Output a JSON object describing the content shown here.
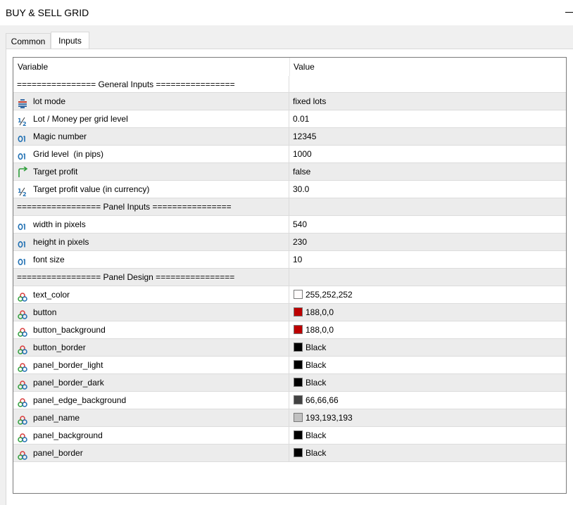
{
  "window": {
    "title": "BUY & SELL GRID"
  },
  "tabs": [
    {
      "label": "Common",
      "active": false
    },
    {
      "label": "Inputs",
      "active": true
    }
  ],
  "table": {
    "headers": {
      "variable": "Variable",
      "value": "Value"
    },
    "rows": [
      {
        "type": "separator",
        "variable": "================ General Inputs ================",
        "value": ""
      },
      {
        "type": "param",
        "icon": "list-icon",
        "variable": "lot mode",
        "value": "fixed lots"
      },
      {
        "type": "param",
        "icon": "fraction-icon",
        "variable": "Lot / Money per grid level",
        "value": "0.01"
      },
      {
        "type": "param",
        "icon": "integer-icon",
        "variable": "Magic number",
        "value": "12345"
      },
      {
        "type": "param",
        "icon": "integer-icon",
        "variable": "Grid level  (in pips)",
        "value": "1000"
      },
      {
        "type": "param",
        "icon": "boolean-arrow-icon",
        "variable": "Target profit",
        "value": "false"
      },
      {
        "type": "param",
        "icon": "fraction-icon",
        "variable": "Target profit value (in currency)",
        "value": "30.0"
      },
      {
        "type": "separator",
        "variable": "================= Panel Inputs ================",
        "value": ""
      },
      {
        "type": "param",
        "icon": "integer-icon",
        "variable": "width in pixels",
        "value": "540"
      },
      {
        "type": "param",
        "icon": "integer-icon",
        "variable": "height in pixels",
        "value": "230"
      },
      {
        "type": "param",
        "icon": "integer-icon",
        "variable": "font size",
        "value": "10"
      },
      {
        "type": "separator",
        "variable": "================= Panel Design ================",
        "value": ""
      },
      {
        "type": "color",
        "icon": "color-icon",
        "variable": "text_color",
        "value": "255,252,252",
        "swatch": "#fffcfc"
      },
      {
        "type": "color",
        "icon": "color-icon",
        "variable": "button",
        "value": "188,0,0",
        "swatch": "#bc0000"
      },
      {
        "type": "color",
        "icon": "color-icon",
        "variable": "button_background",
        "value": "188,0,0",
        "swatch": "#bc0000"
      },
      {
        "type": "color",
        "icon": "color-icon",
        "variable": "button_border",
        "value": "Black",
        "swatch": "#000000"
      },
      {
        "type": "color",
        "icon": "color-icon",
        "variable": "panel_border_light",
        "value": "Black",
        "swatch": "#000000"
      },
      {
        "type": "color",
        "icon": "color-icon",
        "variable": "panel_border_dark",
        "value": "Black",
        "swatch": "#000000"
      },
      {
        "type": "color",
        "icon": "color-icon",
        "variable": "panel_edge_background",
        "value": "66,66,66",
        "swatch": "#424242"
      },
      {
        "type": "color",
        "icon": "color-icon",
        "variable": "panel_name",
        "value": "193,193,193",
        "swatch": "#c1c1c1"
      },
      {
        "type": "color",
        "icon": "color-icon",
        "variable": "panel_background",
        "value": "Black",
        "swatch": "#000000"
      },
      {
        "type": "color",
        "icon": "color-icon",
        "variable": "panel_border",
        "value": "Black",
        "swatch": "#000000"
      }
    ]
  },
  "colors": {
    "row_alt": "#ececec",
    "integer_icon": "#1f6fb2",
    "boolean_icon": "#2e9e3a",
    "fraction_icon": "#1f6fb2"
  }
}
